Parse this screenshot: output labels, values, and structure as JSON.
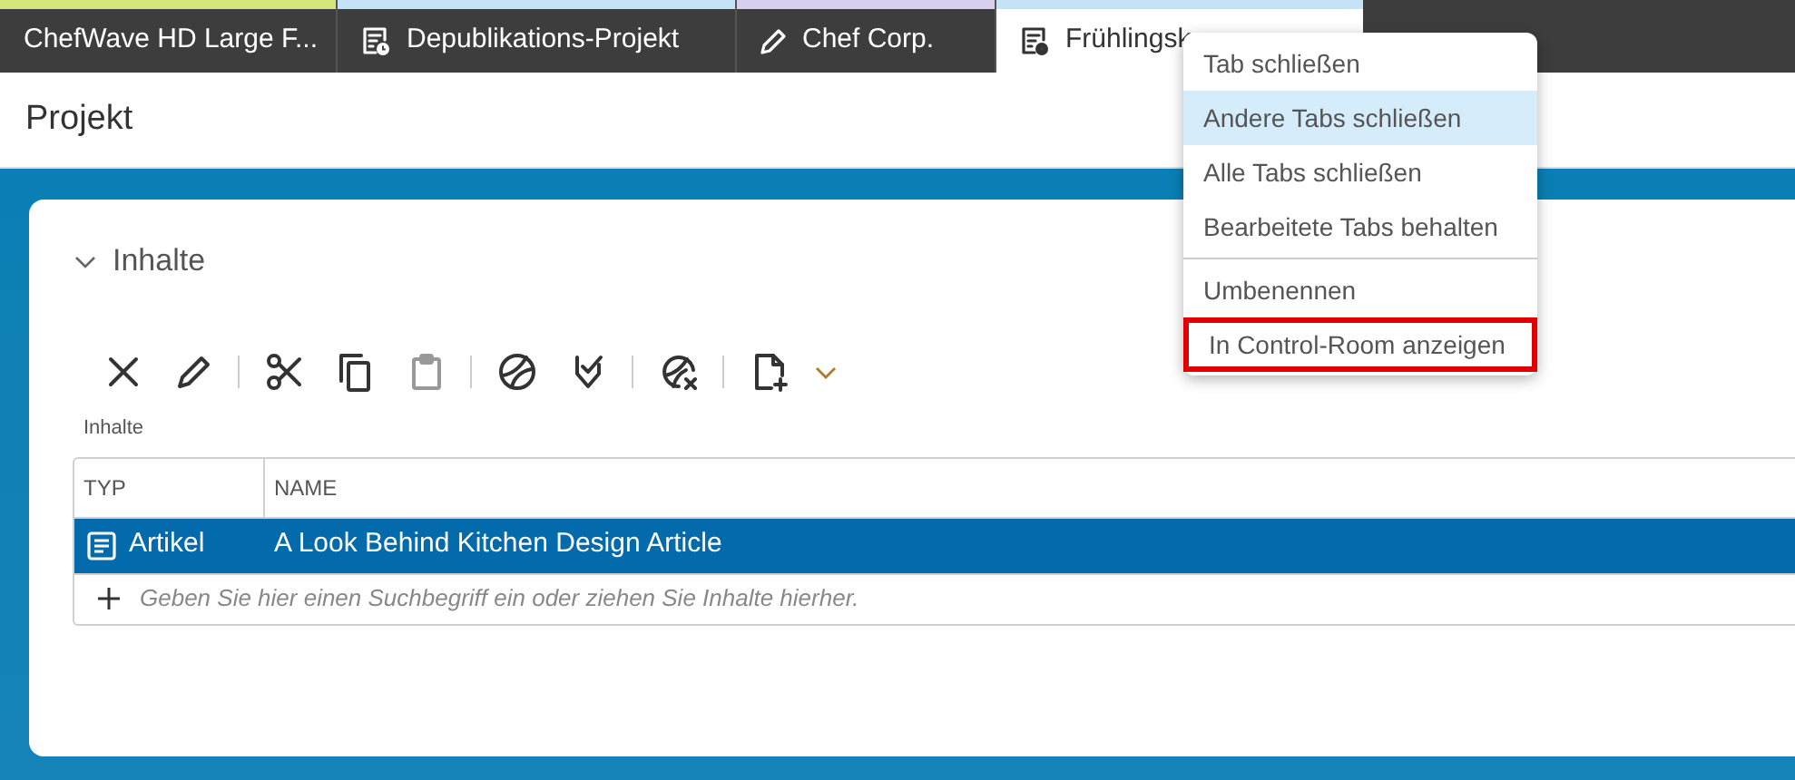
{
  "tabs": [
    {
      "label": "ChefWave HD Large F...",
      "kind": "plain",
      "color": "#d4e87a",
      "selected": false
    },
    {
      "label": "Depublikations-Projekt",
      "kind": "scheduled",
      "color": "#c5e3f6",
      "selected": false
    },
    {
      "label": "Chef Corp.",
      "kind": "edit",
      "color": "#d9d0f0",
      "selected": false
    },
    {
      "label": "Frühlingsk",
      "kind": "scheduled",
      "color": "#c5e3f6",
      "selected": true
    }
  ],
  "header": {
    "title": "Projekt"
  },
  "section": {
    "title": "Inhalte",
    "expanded": true
  },
  "toolbar": [
    {
      "kind": "remove",
      "disabled": false
    },
    {
      "kind": "edit",
      "disabled": false
    },
    {
      "kind": "separator"
    },
    {
      "kind": "cut",
      "disabled": false
    },
    {
      "kind": "copy",
      "disabled": false
    },
    {
      "kind": "paste",
      "disabled": true
    },
    {
      "kind": "separator"
    },
    {
      "kind": "publish",
      "disabled": false
    },
    {
      "kind": "approve",
      "disabled": false
    },
    {
      "kind": "separator"
    },
    {
      "kind": "unpublish",
      "disabled": false
    },
    {
      "kind": "separator"
    },
    {
      "kind": "create",
      "disabled": false
    },
    {
      "kind": "dropdown"
    }
  ],
  "table": {
    "label": "Inhalte",
    "columns": [
      "TYP",
      "NAME"
    ],
    "rows": [
      {
        "type": "Artikel",
        "name": "A Look Behind Kitchen Design Article",
        "selected": true
      }
    ],
    "add_row": {
      "placeholder": "Geben Sie hier einen Suchbegriff ein oder ziehen Sie Inhalte hierher."
    }
  },
  "context_menu": {
    "items": [
      {
        "kind": "item",
        "label": "Tab schließen",
        "selected": false,
        "outlined": false
      },
      {
        "kind": "item",
        "label": "Andere Tabs schließen",
        "selected": true,
        "outlined": false
      },
      {
        "kind": "item",
        "label": "Alle Tabs schließen",
        "selected": false,
        "outlined": false
      },
      {
        "kind": "item",
        "label": "Bearbeitete Tabs behalten",
        "selected": false,
        "outlined": false
      },
      {
        "kind": "separator"
      },
      {
        "kind": "item",
        "label": "Umbenennen",
        "selected": false,
        "outlined": false
      },
      {
        "kind": "item",
        "label": "In Control-Room anzeigen",
        "selected": false,
        "outlined": true
      }
    ]
  }
}
